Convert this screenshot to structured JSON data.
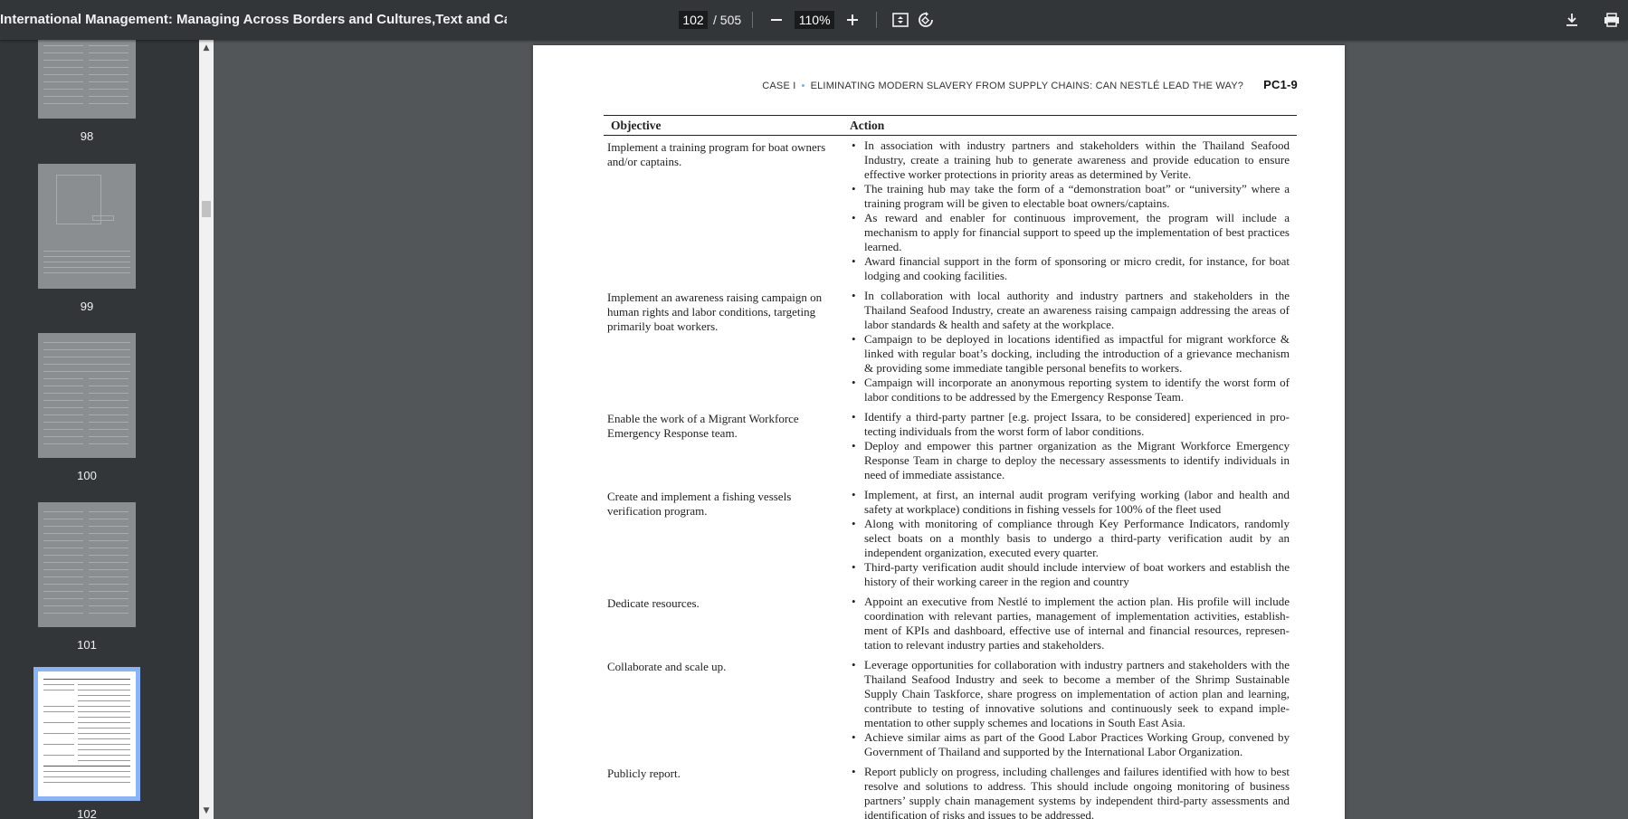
{
  "toolbar": {
    "title": "International Management: Managing Across Borders and Cultures,Text and Cases",
    "current_page": "102",
    "total_pages": "/ 505",
    "zoom": "110%"
  },
  "sidebar": {
    "thumbnails": [
      {
        "label": "98"
      },
      {
        "label": "99"
      },
      {
        "label": "100"
      },
      {
        "label": "101"
      },
      {
        "label": "102"
      }
    ]
  },
  "page": {
    "running_head_case": "CASE I",
    "running_head_title": "ELIMINATING MODERN SLAVERY FROM SUPPLY CHAINS: CAN NESTLÉ LEAD THE WAY?",
    "page_number": "PC1-9",
    "table": {
      "headers": [
        "Objective",
        "Action"
      ],
      "rows": [
        {
          "objective": "Implement a training program for boat owners and/or captains.",
          "actions": [
            "In association with industry partners and stakeholders within the Thailand Seafood Industry, create a training hub to generate awareness and provide education to ensure effective worker protections in priority areas as determined by Verite.",
            "The training hub may take the form of a “demonstration boat” or “university” where a training program will be given to electable boat owners/captains.",
            "As reward and enabler for continuous improvement, the program will include a mechanism to apply for financial support to speed up the implementation of best practices learned.",
            "Award financial support in the form of sponsoring or micro credit, for instance, for boat lodging and cooking facilities."
          ]
        },
        {
          "objective": "Implement an awareness raising campaign on human rights and labor conditions, targeting primarily boat workers.",
          "actions": [
            "In collaboration with local authority and industry partners and stakeholders in the Thailand Seafood Industry, create an awareness raising campaign addressing the areas of labor standards & health and safety at the workplace.",
            "Campaign to be deployed in locations identified as impactful for migrant workforce & linked with regular boat’s docking, including the introduction of a grievance mechanism & providing some immediate tangible personal benefits to workers.",
            "Campaign will incorporate an anonymous reporting system to identify the worst form of labor conditions to be addressed by the Emergency Response Team."
          ]
        },
        {
          "objective": "Enable the work of a Migrant Workforce Emergency Response team.",
          "actions": [
            "Identify a third-party partner [e.g. project Issara, to be considered] experienced in pro-tecting individuals from the worst form of labor conditions.",
            "Deploy and empower this partner organization as the Migrant Workforce Emergency Response Team in charge to deploy the necessary assessments to identify individuals in need of immediate assistance."
          ]
        },
        {
          "objective": "Create and implement a fishing vessels verification program.",
          "actions": [
            "Implement, at first, an internal audit program verifying working (labor and health and safety at workplace) conditions in fishing vessels for 100% of the fleet used",
            "Along with monitoring of compliance through Key Performance Indicators, randomly select boats on a monthly basis to undergo a third-party verification audit by an independent organization, executed every quarter.",
            "Third-party verification audit should include interview of boat workers and establish the history of their working career in the region and country"
          ]
        },
        {
          "objective": "Dedicate resources.",
          "actions": [
            "Appoint an executive from Nestlé to implement the action plan. His profile will include coordination with relevant parties, management of implementation activities, establish-ment of KPIs and dashboard, effective use of internal and financial resources, represen-tation to relevant industry parties and stakeholders."
          ]
        },
        {
          "objective": "Collaborate and scale up.",
          "actions": [
            "Leverage opportunities for collaboration with industry partners and stakeholders with the Thailand Seafood Industry and seek to become a member of the Shrimp Sustainable Supply Chain Taskforce, share progress on implementation of action plan and learning, contribute to testing of innovative solutions and continuously seek to expand imple-mentation to other supply schemes and locations in South East Asia.",
            "Achieve similar aims as part of the Good Labor Practices Working Group, convened by Government of Thailand and supported by the International Labor Organization."
          ]
        },
        {
          "objective": "Publicly report.",
          "actions": [
            "Report publicly on progress, including challenges and failures identified with how to best resolve and solutions to address. This should include ongoing monitoring of business partners’ supply chain management systems by independent third-party assessments and identification of risks and issues to be addressed."
          ]
        }
      ]
    }
  },
  "icons": {
    "zoom_out": "minus-icon",
    "zoom_in": "plus-icon",
    "fit": "fit-page-icon",
    "rotate": "rotate-icon",
    "download": "download-icon",
    "print": "print-icon"
  }
}
